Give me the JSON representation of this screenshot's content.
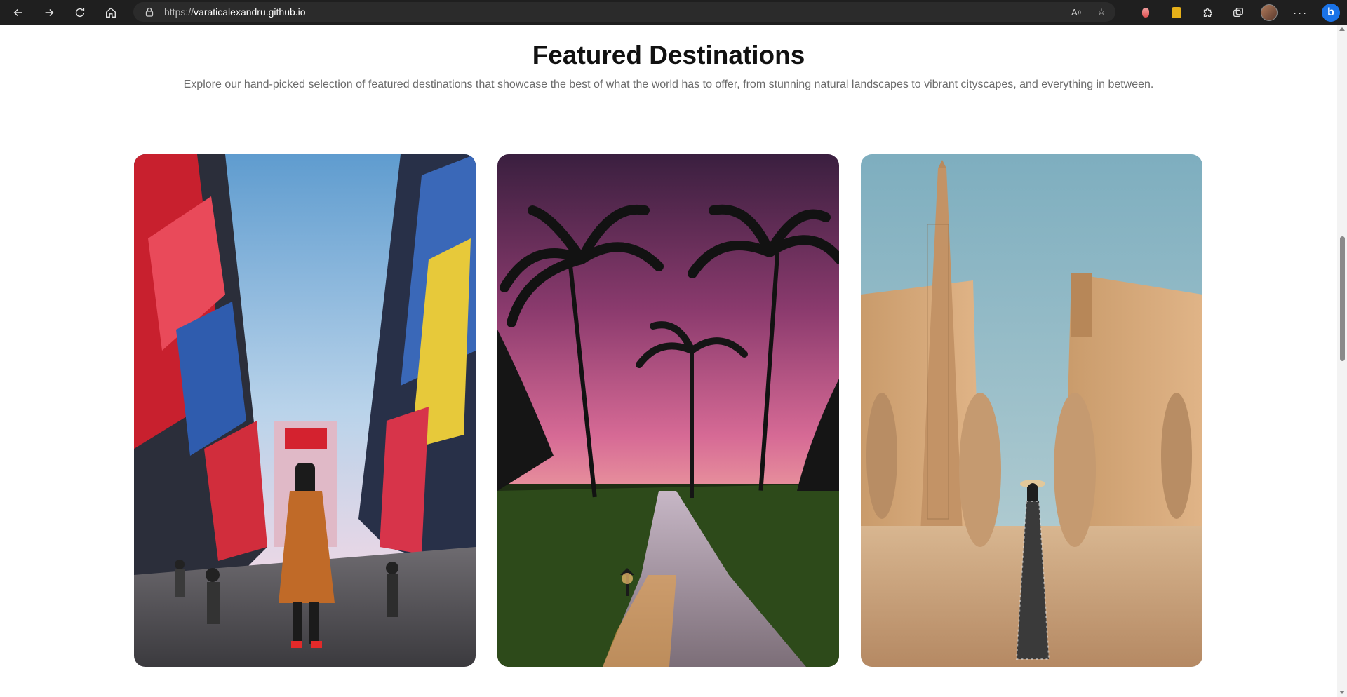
{
  "browser": {
    "url_scheme": "https://",
    "url_host": "varaticalexandru.github.io",
    "nav": [
      "back-icon",
      "forward-icon",
      "refresh-icon",
      "home-icon"
    ],
    "bing_label": "b"
  },
  "section": {
    "title": "Featured Destinations",
    "subtitle": "Explore our hand-picked selection of featured destinations that showcase the best of what the world has to offer, from stunning natural landscapes to vibrant cityscapes, and everything in between."
  },
  "destinations": [
    {
      "scene": "tokyo-city-street",
      "sky": "#7fb0d8",
      "accent": "#d83a3a"
    },
    {
      "scene": "palm-sunset-boardwalk",
      "sky": "#c2548a",
      "accent": "#f5b96a"
    },
    {
      "scene": "egyptian-temple-obelisk",
      "sky": "#8cb6c4",
      "accent": "#c99867"
    }
  ]
}
